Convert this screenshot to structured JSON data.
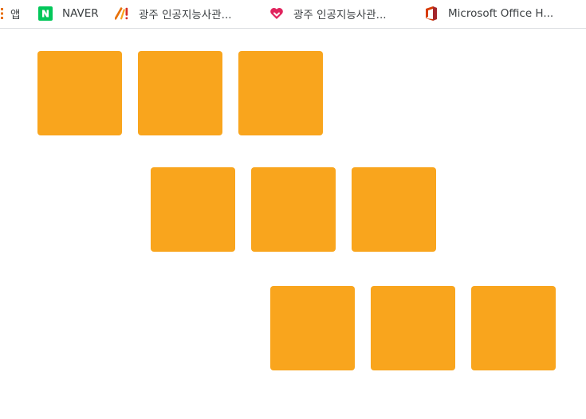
{
  "bookmarks_bar": {
    "items": [
      {
        "label": "앱",
        "icon": "apps-grid-icon"
      },
      {
        "label": "NAVER",
        "icon": "naver-logo-icon"
      },
      {
        "label": "광주 인공지능사관...",
        "icon": "exclamation-logo-icon"
      },
      {
        "label": "광주 인공지능사관...",
        "icon": "heart-logo-icon"
      },
      {
        "label": "Microsoft Office H...",
        "icon": "office-logo-icon"
      }
    ]
  },
  "colors": {
    "box": "#f9a51d",
    "naver": "#03c75a",
    "office": "#d83b01"
  },
  "boxes": {
    "rows": [
      {
        "count": 3
      },
      {
        "count": 3
      },
      {
        "count": 3
      }
    ]
  }
}
